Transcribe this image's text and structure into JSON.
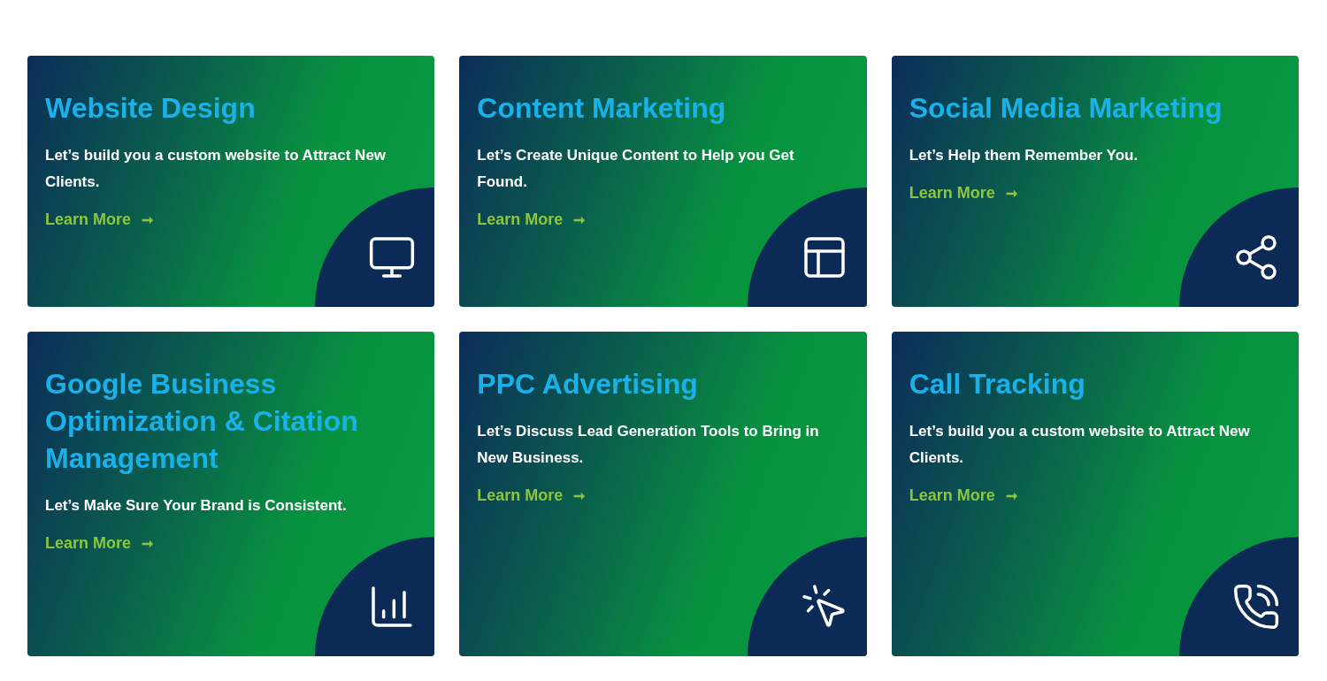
{
  "cards": [
    {
      "title": "Website Design",
      "description": "Let’s build you a custom website to Attract New Clients.",
      "link": "Learn More",
      "arrow": "➞"
    },
    {
      "title": "Content Marketing",
      "description": "Let’s Create Unique Content to Help you Get Found.",
      "link": "Learn More",
      "arrow": "➞"
    },
    {
      "title": "Social Media Marketing",
      "description": "Let’s Help them Remember You.",
      "link": "Learn More",
      "arrow": "➞"
    },
    {
      "title": "Google Business Optimization & Citation Management",
      "description": "Let’s Make Sure Your Brand is Consistent.",
      "link": "Learn More",
      "arrow": "➞"
    },
    {
      "title": "PPC Advertising",
      "description": "Let’s Discuss Lead Generation Tools to Bring in New Business.",
      "link": "Learn More",
      "arrow": "➞"
    },
    {
      "title": "Call Tracking",
      "description": "Let’s build you a custom website to Attract New Clients.",
      "link": "Learn More",
      "arrow": "➞"
    }
  ]
}
